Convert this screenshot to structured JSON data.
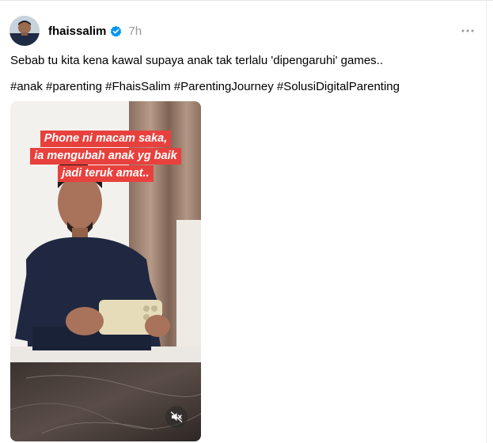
{
  "post": {
    "username": "fhaissalim",
    "time": "7h",
    "more_icon": "more-horizontal-icon",
    "verified_icon": "verified-badge-icon",
    "caption": "Sebab tu kita kena kawal supaya anak tak terlalu 'dipengaruhi' games..",
    "hashtags": "#anak #parenting #FhaisSalim #ParentingJourney #SolusiDigitalParenting"
  },
  "video": {
    "overlay_lines": [
      "Phone ni macam saka,",
      "ia mengubah anak yg baik",
      "jadi teruk amat.."
    ],
    "mute_icon": "speaker-muted-icon"
  },
  "colors": {
    "overlay_bg": "#e8413d",
    "verified": "#0095f6",
    "timestamp": "#999999"
  }
}
